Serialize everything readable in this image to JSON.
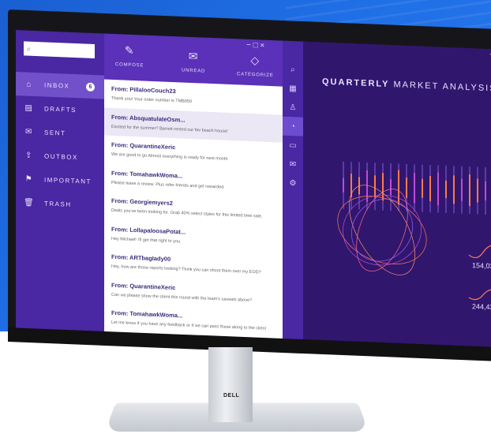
{
  "window": {
    "controls": "− □ ×",
    "dash_controls": "− □ ×"
  },
  "search": {
    "icon": "search-icon"
  },
  "nav": [
    {
      "label": "INBOX",
      "icon": "inbox-icon",
      "glyph": "⌂",
      "badge": "6"
    },
    {
      "label": "DRAFTS",
      "icon": "drafts-icon",
      "glyph": "▤"
    },
    {
      "label": "SENT",
      "icon": "sent-icon",
      "glyph": "✉"
    },
    {
      "label": "OUTBOX",
      "icon": "outbox-icon",
      "glyph": "⇪"
    },
    {
      "label": "IMPORTANT",
      "icon": "flag-icon",
      "glyph": "⚑"
    },
    {
      "label": "TRASH",
      "icon": "trash-icon",
      "glyph": "🗑"
    }
  ],
  "toolbar": {
    "compose": "COMPOSE",
    "unread": "UNREAD",
    "categorize": "CATEGORIZE"
  },
  "emails": [
    {
      "from": "From: PillalooCouch23",
      "preview": "Thank you! Your order number is TMB050"
    },
    {
      "from": "From: AbsquatulateOsm...",
      "preview": "Excited for the summer? Barrett rented our fav beach house!"
    },
    {
      "from": "From: QuarantineXeric",
      "preview": "We are good to go Almost everything is ready for next month"
    },
    {
      "from": "From: TomahawkWoma...",
      "preview": "Please leave a review. Plus refer friends and get rewarded."
    },
    {
      "from": "From: Georgiemyers2",
      "preview": "Deals you've been looking for. Grab 40% select styles for this limited time sale."
    },
    {
      "from": "From: LollapaloosaPotat...",
      "preview": "Hey Michael! I'll get that right to you."
    },
    {
      "from": "From: ARTbagIady00",
      "preview": "Hey, how are those reports looking? Think you can shoot them over my EOD?"
    },
    {
      "from": "From: QuarantineXeric",
      "preview": "Can we please show the client this round with the team's caveats above?"
    },
    {
      "from": "From: TomahawkWoma...",
      "preview": "Let me know if you have any feedback or if we can pass these along to the client"
    }
  ],
  "dashboard": {
    "title_bold": "QUARTERLY",
    "title_rest": " MARKET ANALYSIS",
    "stat1": "154,03",
    "stat2": "244,43",
    "accent": "#ff7a4d",
    "accent2": "#c04bd8"
  },
  "brand": "DELL"
}
